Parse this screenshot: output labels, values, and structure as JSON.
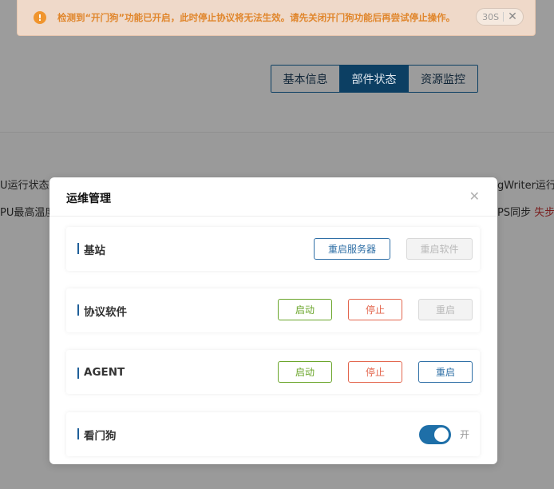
{
  "alert": {
    "message": "检测到“开门狗”功能已开启，此时停止协议将无法生效。请先关闭开门狗功能后再尝试停止操作。",
    "countdown": "30S",
    "icon": "warning-icon",
    "close_icon": "close-icon"
  },
  "tabs": [
    {
      "label": "基本信息"
    },
    {
      "label": "部件状态"
    },
    {
      "label": "资源监控"
    }
  ],
  "background": {
    "left_row1": "U运行状态",
    "left_row2": "PU最高温度",
    "right_row1": "gWriter运行",
    "right_row2_label": "PS同步",
    "right_row2_value": "失步"
  },
  "modal": {
    "title": "运维管理",
    "close_icon": "close-icon",
    "sections": {
      "base_station": {
        "label": "基站",
        "restart_server": "重启服务器",
        "restart_software": "重启软件"
      },
      "protocol_software": {
        "label": "协议软件",
        "start": "启动",
        "stop": "停止",
        "restart": "重启"
      },
      "agent": {
        "label": "AGENT",
        "start": "启动",
        "stop": "停止",
        "restart": "重启"
      },
      "watchdog": {
        "label": "看门狗",
        "toggle_text": "开"
      }
    }
  },
  "colors": {
    "accent": "#1e6fa8",
    "warning": "#f0952e",
    "green": "#6aa52a",
    "red": "#e3664e"
  }
}
